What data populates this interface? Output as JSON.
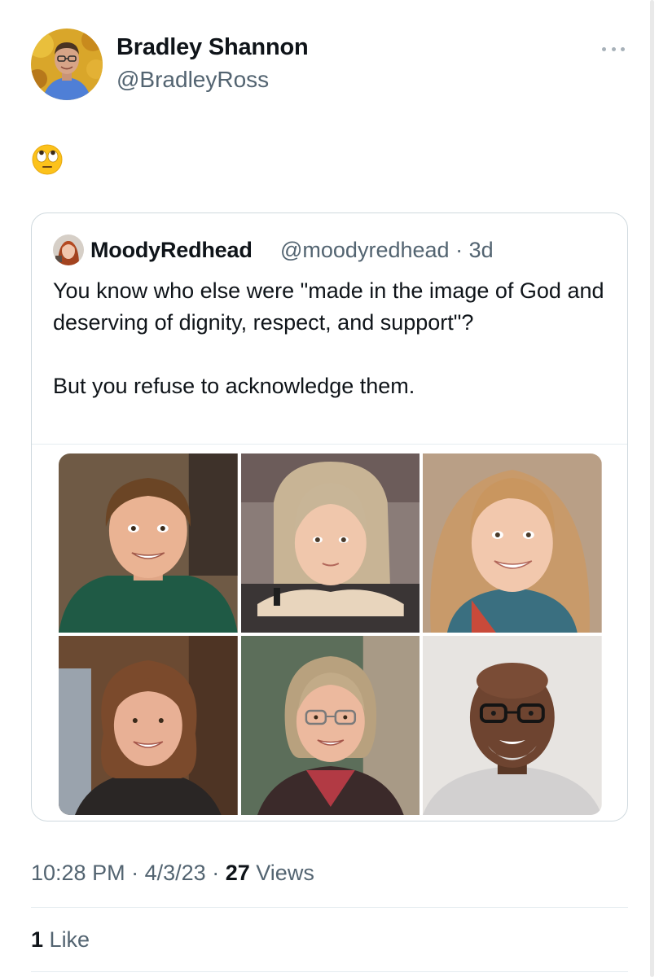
{
  "tweet": {
    "author": {
      "name": "Bradley Shannon",
      "handle": "@BradleyRoss",
      "avatar_icon": "profile-photo"
    },
    "more_icon": "ellipsis-icon",
    "text_emoji": "face-with-rolling-eyes",
    "quoted": {
      "author_name": "MoodyRedhead",
      "author_handle": "@moodyredhead",
      "separator": "·",
      "age": "3d",
      "text_line1": "You know who else were \"made in the image of God and deserving of dignity, respect, and support\"?",
      "text_line2": "But you refuse to acknowledge them.",
      "photos": [
        {
          "name": "photo-boy"
        },
        {
          "name": "photo-girl-resting-chin"
        },
        {
          "name": "photo-girl-smiling"
        },
        {
          "name": "photo-woman-curly-hair"
        },
        {
          "name": "photo-woman-glasses"
        },
        {
          "name": "photo-man-glasses"
        }
      ]
    },
    "footer": {
      "time": "10:28 PM",
      "separator": "·",
      "date": "4/3/23",
      "views_count": "27",
      "views_label": "Views",
      "likes_count": "1",
      "likes_label": "Like"
    }
  }
}
